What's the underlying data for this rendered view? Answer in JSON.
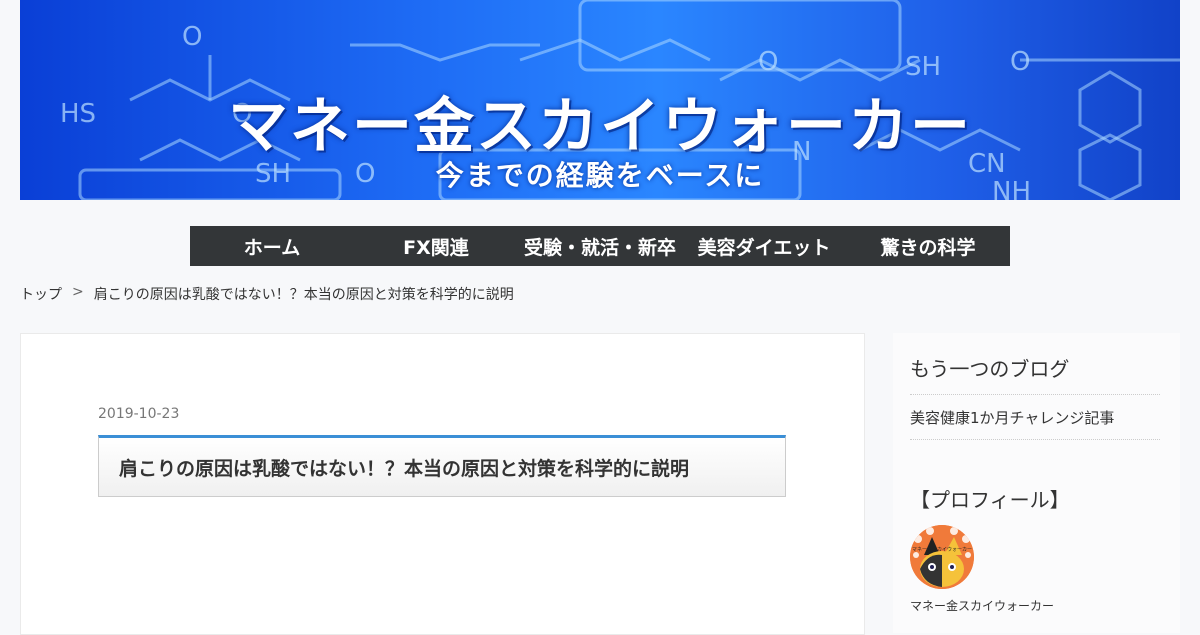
{
  "header": {
    "title": "マネー金スカイウォーカー",
    "subtitle": "今までの経験をベースに",
    "decor_labels": [
      "O",
      "HS",
      "SH",
      "O",
      "SH",
      "O",
      "CN",
      "NH",
      "N",
      "O",
      "O"
    ]
  },
  "nav": {
    "items": [
      {
        "label": "ホーム"
      },
      {
        "label": "FX関連"
      },
      {
        "label": "受験・就活・新卒"
      },
      {
        "label": "美容ダイエット"
      },
      {
        "label": "驚きの科学"
      }
    ]
  },
  "breadcrumb": {
    "home": "トップ",
    "separator": ">",
    "current": "肩こりの原因は乳酸ではない！？本当の原因と対策を科学的に説明"
  },
  "post": {
    "date": "2019-10-23",
    "title": "肩こりの原因は乳酸ではない！？本当の原因と対策を科学的に説明"
  },
  "sidebar": {
    "blog_widget_title": "もう一つのブログ",
    "blog_link": "美容健康1か月チャレンジ記事",
    "profile_widget_title": "【プロフィール】",
    "profile_name": "マネー金スカイウォーカー",
    "avatar_text": "マネー金スカイウォーカー"
  },
  "colors": {
    "nav_bg": "#333638",
    "header_blue": "#1e6cf5",
    "title_accent": "#3b8fd6"
  }
}
